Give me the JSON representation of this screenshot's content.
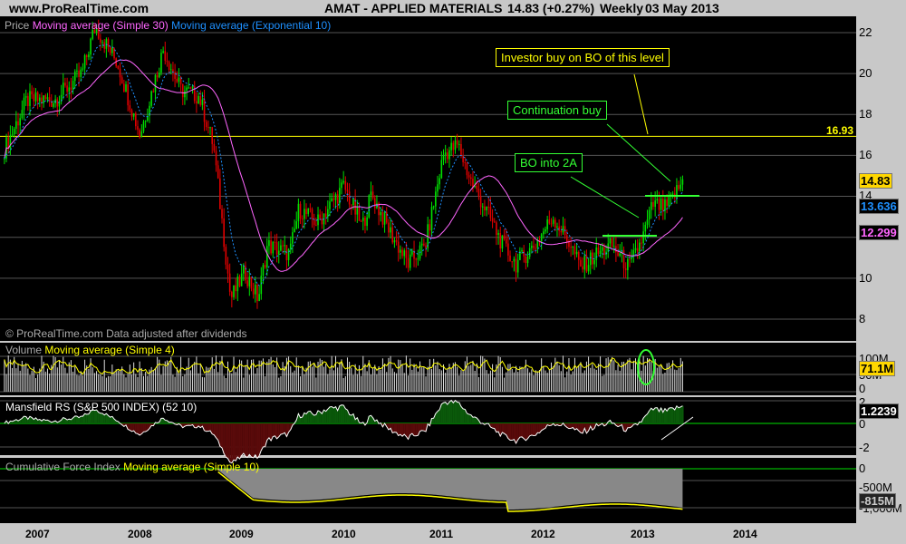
{
  "header": {
    "site": "www.ProRealTime.com",
    "title": "AMAT - APPLIED MATERIALS",
    "price": "14.83 (+0.27%)",
    "period": "Weekly",
    "date": "03 May 2013"
  },
  "price_panel": {
    "label": "Price",
    "sma_label": "Moving average (Simple 30)",
    "ema_label": "Moving average (Exponential 10)",
    "footer": "© ProRealTime.com  Data adjusted after dividends",
    "axis": [
      "22",
      "20",
      "18",
      "16",
      "14",
      "12",
      "10",
      "8"
    ],
    "level_line": "16.93",
    "last_price": "14.83",
    "ema_value": "13.636",
    "sma_value": "12.299"
  },
  "volume_panel": {
    "label": "Volume",
    "ma_label": "Moving average (Simple 4)",
    "axis": [
      "100M",
      "50M",
      "0"
    ],
    "last": "71.1M"
  },
  "mansfield_panel": {
    "label": "Mansfield RS (S&P 500 INDEX) (52 10)",
    "axis": [
      "2",
      "0",
      "-2"
    ],
    "last": "1.2239"
  },
  "cfi_panel": {
    "label": "Cumulative Force Index",
    "ma_label": "Moving average (Simple 10)",
    "axis": [
      "0",
      "-500M",
      "-1,000M"
    ],
    "last": "-815M"
  },
  "annotations": {
    "investor": "Investor buy on BO of this level",
    "continuation": "Continuation buy",
    "bo2a": "BO into 2A"
  },
  "x_axis": [
    "2007",
    "2008",
    "2009",
    "2010",
    "2011",
    "2012",
    "2013",
    "2014"
  ],
  "colors": {
    "up": "#00e000",
    "down": "#e00000",
    "sma": "#ff66ff",
    "ema": "#1e90ff",
    "level": "#ffff00",
    "note_green": "#33ff33"
  },
  "chart_data": {
    "type": "candlestick",
    "symbol": "AMAT",
    "frequency": "weekly",
    "ylim": [
      8,
      22.5
    ],
    "price_keypoints": [
      [
        2006.67,
        16.3
      ],
      [
        2006.89,
        18.7
      ],
      [
        2007.16,
        18.7
      ],
      [
        2007.43,
        20.0
      ],
      [
        2007.56,
        22.3
      ],
      [
        2007.78,
        20.5
      ],
      [
        2008.0,
        17.0
      ],
      [
        2008.23,
        21.2
      ],
      [
        2008.4,
        19.2
      ],
      [
        2008.58,
        18.9
      ],
      [
        2008.72,
        16.5
      ],
      [
        2008.8,
        13.0
      ],
      [
        2008.89,
        9.0
      ],
      [
        2009.03,
        10.3
      ],
      [
        2009.16,
        9.0
      ],
      [
        2009.25,
        11.6
      ],
      [
        2009.47,
        11.2
      ],
      [
        2009.56,
        13.4
      ],
      [
        2009.74,
        12.7
      ],
      [
        2010.0,
        14.5
      ],
      [
        2010.18,
        12.5
      ],
      [
        2010.27,
        14.1
      ],
      [
        2010.45,
        12.3
      ],
      [
        2010.63,
        10.7
      ],
      [
        2010.8,
        11.6
      ],
      [
        2010.98,
        16.1
      ],
      [
        2011.12,
        16.5
      ],
      [
        2011.25,
        14.7
      ],
      [
        2011.43,
        13.0
      ],
      [
        2011.56,
        11.6
      ],
      [
        2011.69,
        10.7
      ],
      [
        2011.87,
        11.6
      ],
      [
        2012.05,
        13.0
      ],
      [
        2012.23,
        11.6
      ],
      [
        2012.32,
        10.5
      ],
      [
        2012.49,
        11.2
      ],
      [
        2012.63,
        11.6
      ],
      [
        2012.8,
        10.5
      ],
      [
        2012.94,
        12.1
      ],
      [
        2013.03,
        13.6
      ],
      [
        2013.16,
        13.4
      ],
      [
        2013.34,
        14.83
      ]
    ]
  }
}
